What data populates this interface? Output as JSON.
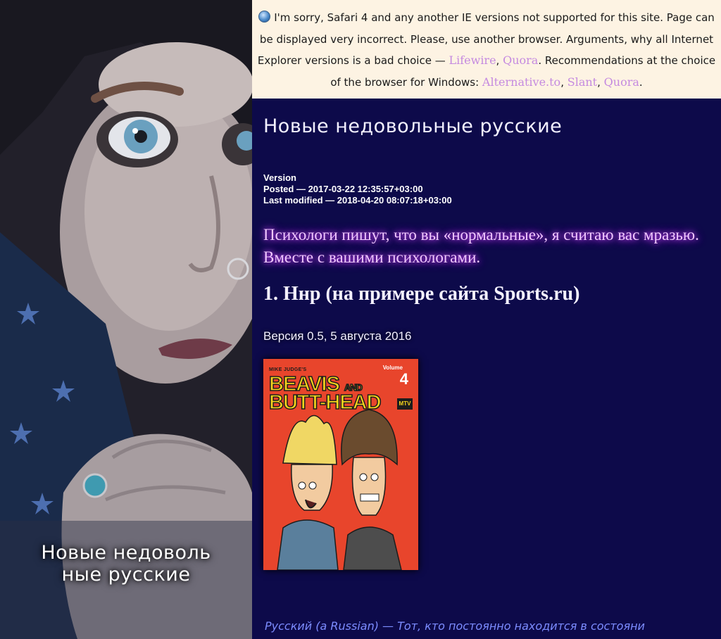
{
  "colors": {
    "page_background": "#0d0a4a",
    "warning_background": "#fdf3e3",
    "link": "#c58ae0",
    "lead_glow": "#d04cff",
    "footer_text": "#7c8cff"
  },
  "hero": {
    "caption_line1": "Новые недоволь",
    "caption_line2": "ные русские"
  },
  "warning": {
    "icon": "globe-icon",
    "text1": "I'm sorry, Safari 4 and any another IE versions not supported for this site. Page can be displayed very incorrect. Please, use another browser. Arguments, why all Internet Explorer versions is a bad choice —",
    "links_why": [
      "Lifewire",
      "Quora"
    ],
    "text2": "Recommendations at the choice of the browser for Windows:",
    "links_recommend": [
      "Alternative.to",
      "Slant",
      "Quora"
    ]
  },
  "article": {
    "title": "Новые недовольные русские",
    "meta": {
      "version": "Version",
      "posted": "Posted — 2017-03-22 12:35:57+03:00",
      "modified": "Last modified — 2018-04-20 08:07:18+03:00"
    },
    "lead": "Психологи пишут, что вы «нормальные», я считаю вас мразью. Вместе с вашими психологами.",
    "section_heading": "1. Ннр (на примере сайта Sports.ru)",
    "version_note": "Версия 0.5, 5 августа 2016",
    "cover": {
      "small_title": "MIKE JUDGE'S",
      "volume_label": "Volume",
      "volume_number": "4",
      "line1_big": "BEAVIS",
      "line1_small": "AND",
      "line2": "BUTT-HEAD",
      "logo": "MTV"
    },
    "footer_line": "Русский (a Russian) — Тот, кто постоянно находится в состояни"
  }
}
